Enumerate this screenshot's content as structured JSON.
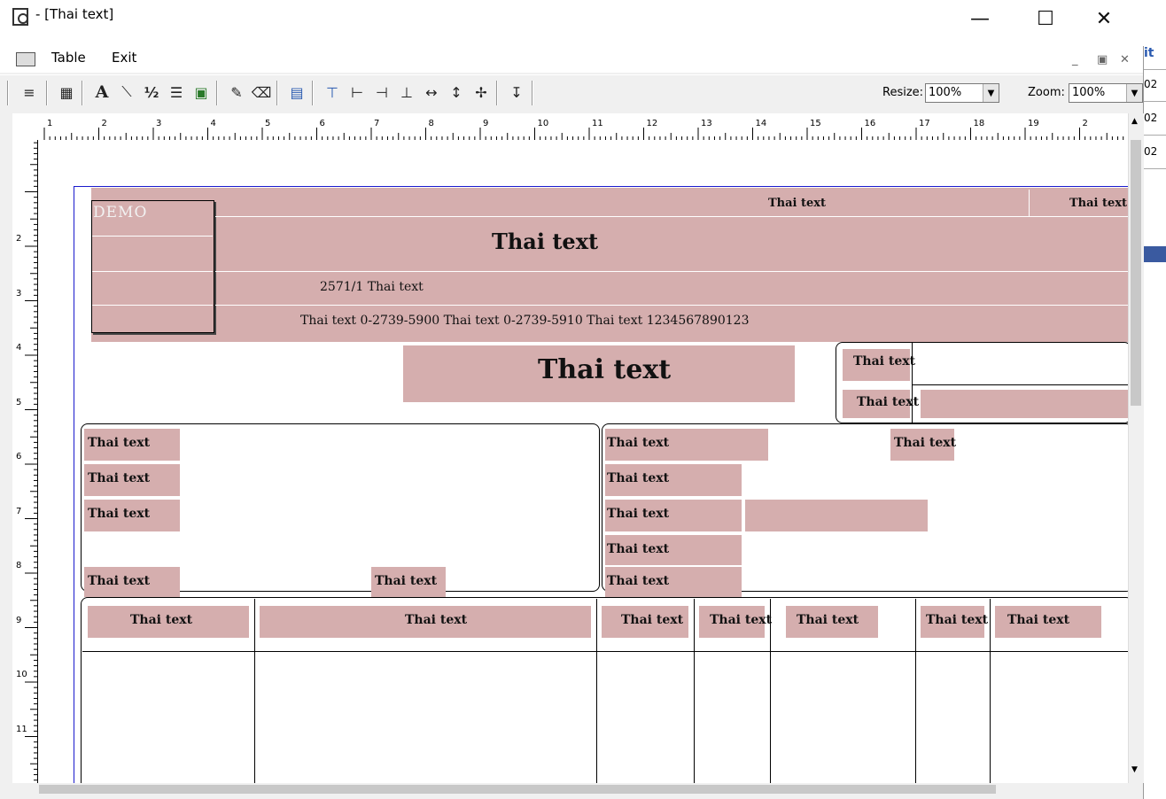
{
  "window": {
    "title": "- [Thai text]"
  },
  "menu": {
    "items": [
      "Table",
      "Exit"
    ]
  },
  "toolbar": {
    "resize_label": "Resize:",
    "resize_value": "100%",
    "zoom_label": "Zoom:",
    "zoom_value": "100%"
  },
  "ruler": {
    "horizontal": [
      "1",
      "2",
      "3",
      "4",
      "5",
      "6",
      "7",
      "8",
      "9",
      "10",
      "11",
      "12",
      "13",
      "14",
      "15",
      "16",
      "17",
      "18",
      "19",
      "2"
    ],
    "vertical": [
      "2",
      "3",
      "4",
      "5",
      "6",
      "7",
      "8",
      "9",
      "10",
      "11"
    ]
  },
  "report": {
    "logo_text": "DEMO",
    "branch": "Thai text",
    "page": "Thai text",
    "company_name": "Thai text",
    "address": "2571/1 Thai text",
    "contact": "Thai text 0-2739-5900 Thai text 0-2739-5910 Thai text 1234567890123",
    "doc_title": "Thai text",
    "doc_no_label": "Thai text",
    "date_label": "Thai text",
    "customer": {
      "code_label": "Thai text",
      "name_label": "Thai text",
      "address_label": "Thai text",
      "tel_label": "Thai text",
      "fax_label": "Thai text"
    },
    "tax": {
      "taxid_label": "Thai text",
      "branch_label": "Thai text",
      "orig_invoice_label": "Thai text",
      "ref_date_label": "Thai text",
      "reason_label": "Thai text",
      "contact_label": "Thai text"
    },
    "columns": [
      "Thai text",
      "Thai text",
      "Thai text",
      "Thai text",
      "Thai text",
      "Thai text",
      "Thai text"
    ]
  },
  "background_window": {
    "fragments": [
      "it",
      "02",
      "02",
      "02"
    ]
  }
}
